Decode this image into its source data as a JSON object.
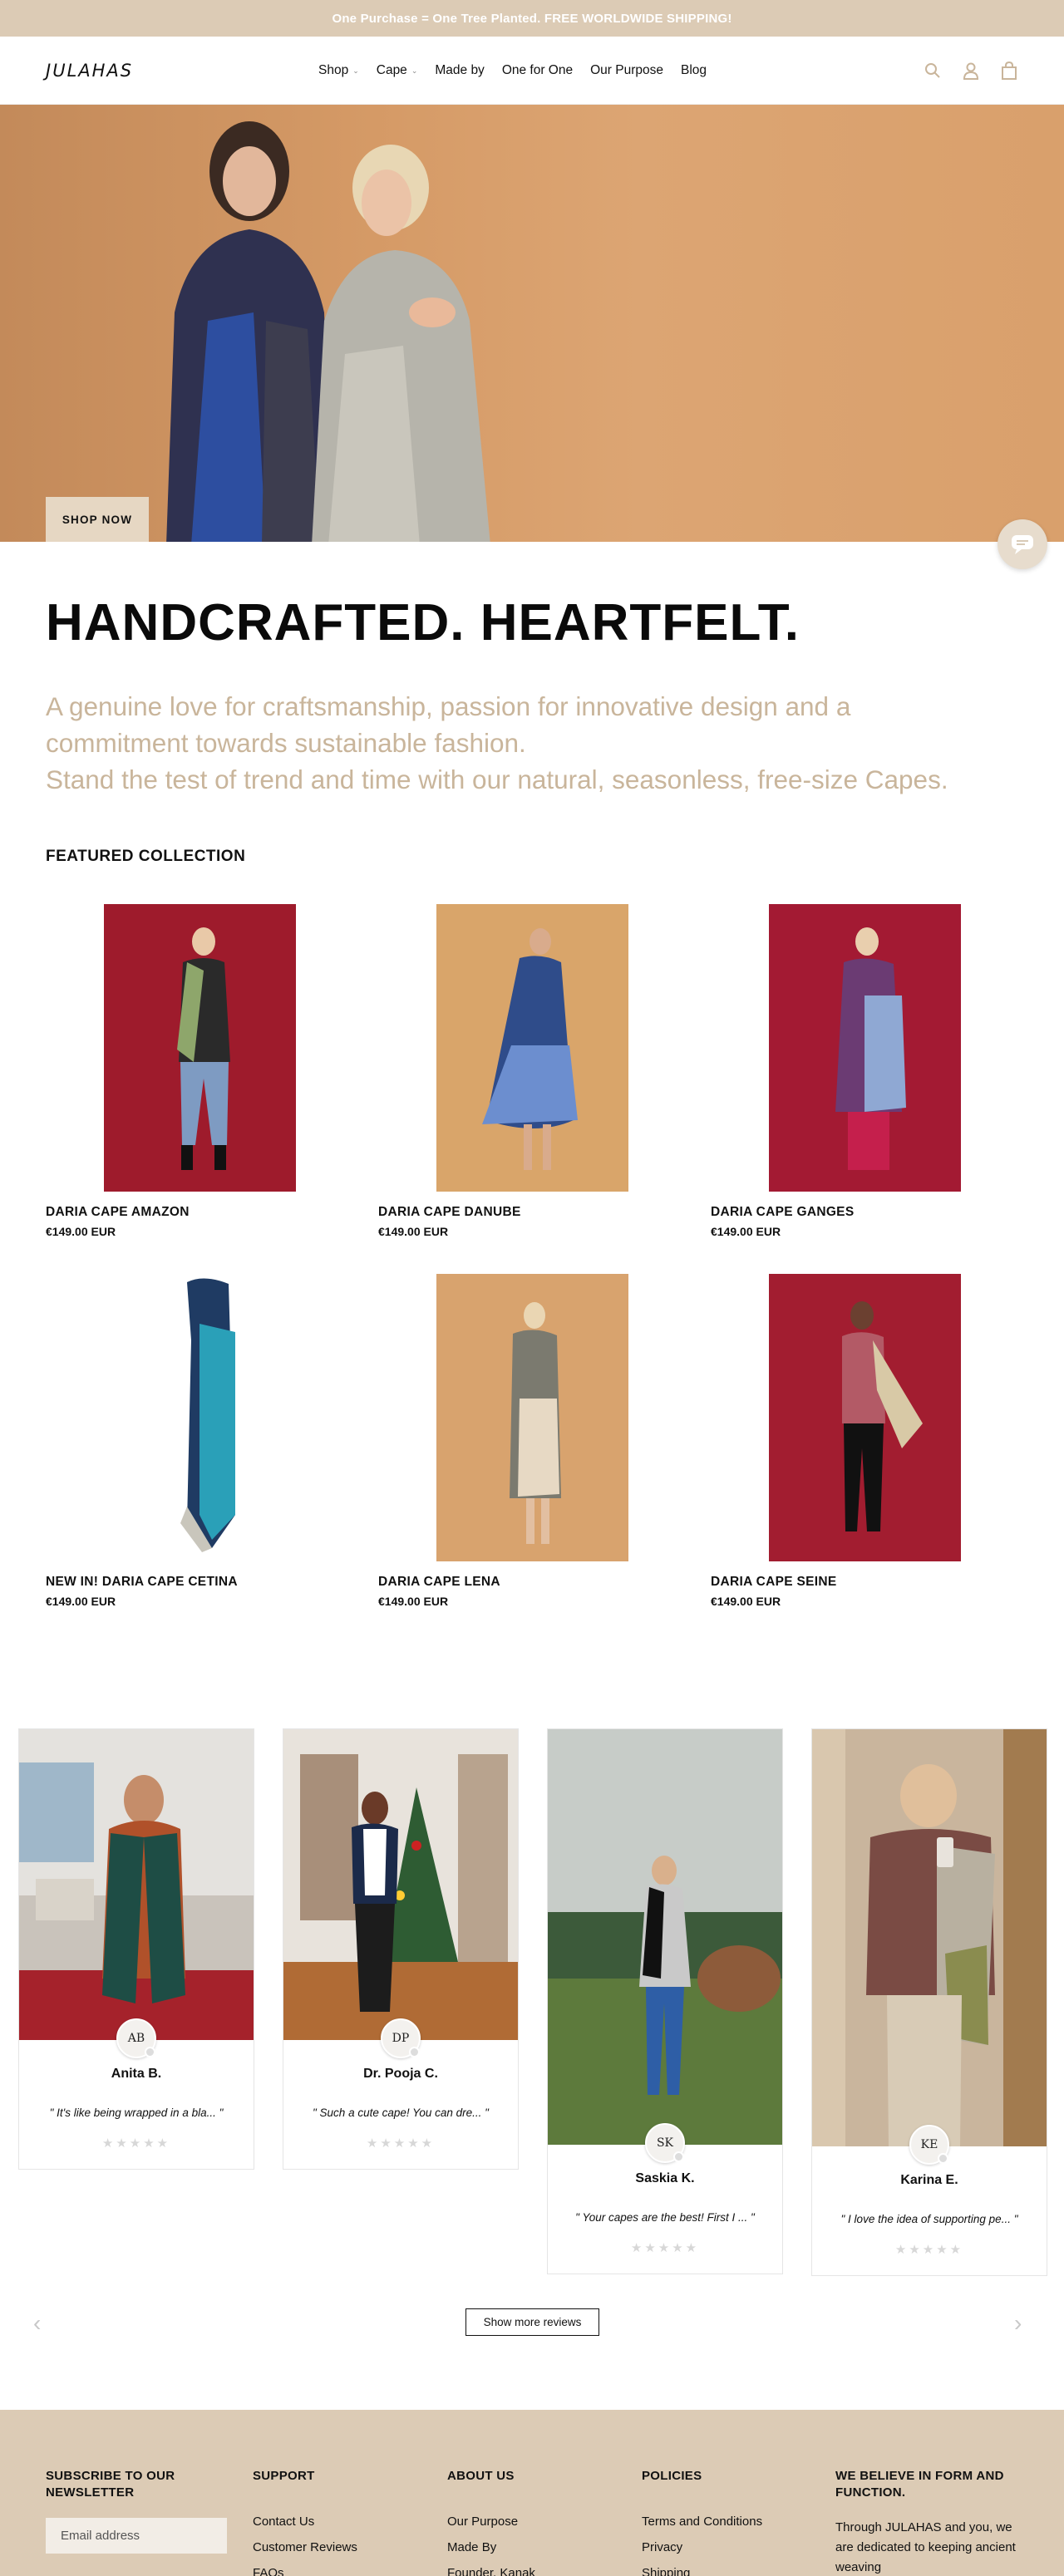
{
  "announcement": "One Purchase = One Tree Planted. FREE WORLDWIDE SHIPPING!",
  "brand": "JULAHAS",
  "nav": [
    {
      "label": "Shop",
      "dropdown": true
    },
    {
      "label": "Cape",
      "dropdown": true
    },
    {
      "label": "Made by",
      "dropdown": false
    },
    {
      "label": "One for One",
      "dropdown": false
    },
    {
      "label": "Our Purpose",
      "dropdown": false
    },
    {
      "label": "Blog",
      "dropdown": false
    }
  ],
  "hero": {
    "button": "SHOP NOW"
  },
  "headline": "HANDCRAFTED. HEARTFELT.",
  "tagline": {
    "line1": "A genuine love for craftsmanship, passion for innovative design and a",
    "line2": "commitment towards sustainable fashion.",
    "line3": "Stand the test of trend and time with our natural, seasonless, free-size Capes."
  },
  "featured": {
    "title": "FEATURED COLLECTION",
    "products": [
      {
        "name": "DARIA CAPE AMAZON",
        "price": "€149.00 EUR"
      },
      {
        "name": "DARIA CAPE DANUBE",
        "price": "€149.00 EUR"
      },
      {
        "name": "DARIA CAPE GANGES",
        "price": "€149.00 EUR"
      },
      {
        "name": "NEW IN! DARIA CAPE CETINA",
        "price": "€149.00 EUR"
      },
      {
        "name": "DARIA CAPE LENA",
        "price": "€149.00 EUR"
      },
      {
        "name": "DARIA CAPE SEINE",
        "price": "€149.00 EUR"
      }
    ]
  },
  "reviews": {
    "items": [
      {
        "initials": "AB",
        "name": "Anita B.",
        "quote": "\" It's like being wrapped in a bla... \"",
        "rating": 5
      },
      {
        "initials": "DP",
        "name": "Dr. Pooja C.",
        "quote": "\" Such a cute cape! You can dre... \"",
        "rating": 5
      },
      {
        "initials": "SK",
        "name": "Saskia K.",
        "quote": "\" Your capes are the best! First I ... \"",
        "rating": 5
      },
      {
        "initials": "KE",
        "name": "Karina E.",
        "quote": "\" I love the idea of supporting pe... \"",
        "rating": 5
      }
    ],
    "show_more": "Show more reviews"
  },
  "footer": {
    "newsletter": {
      "title": "SUBSCRIBE TO OUR NEWSLETTER",
      "placeholder": "Email address"
    },
    "support": {
      "title": "SUPPORT",
      "links": [
        "Contact Us",
        "Customer Reviews",
        "FAQs"
      ]
    },
    "about": {
      "title": "ABOUT US",
      "links": [
        "Our Purpose",
        "Made By",
        "Founder, Kanak"
      ]
    },
    "policies": {
      "title": "POLICIES",
      "links": [
        "Terms and Conditions",
        "Privacy",
        "Shipping"
      ]
    },
    "believe": {
      "title": "WE BELIEVE IN FORM AND FUNCTION.",
      "text": "Through JULAHAS and you, we are dedicated to keeping ancient weaving"
    }
  },
  "colors": {
    "accent": "#dccbb5",
    "tagline": "#c9b59b",
    "hero_bg": "#d59a66"
  }
}
